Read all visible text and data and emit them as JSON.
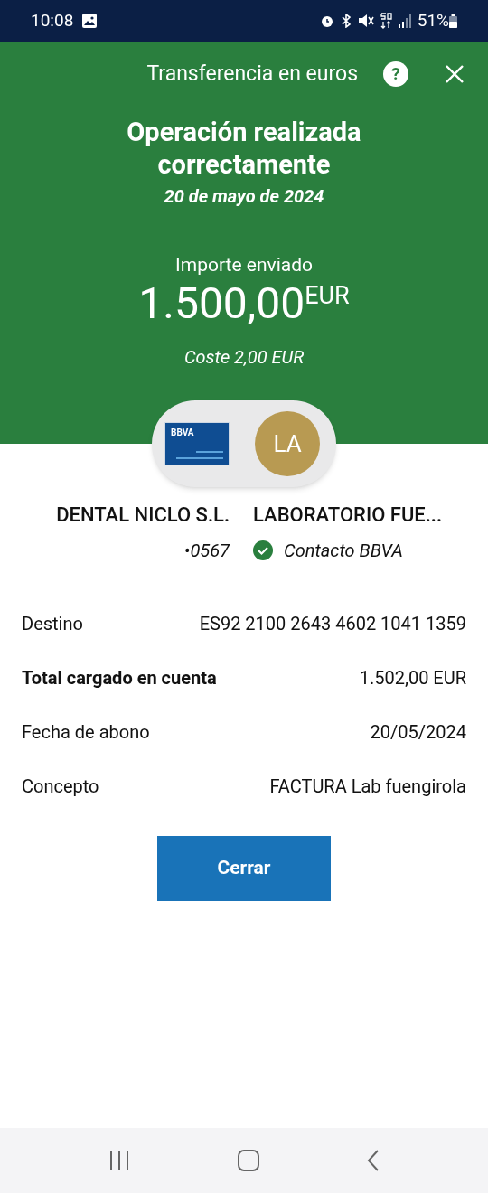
{
  "status_bar": {
    "time": "10:08",
    "battery": "51%"
  },
  "header": {
    "title": "Transferencia en euros",
    "help_icon": "?"
  },
  "result": {
    "title": "Operación realizada correctamente",
    "date": "20 de mayo de 2024",
    "amount_label": "Importe enviado",
    "amount": "1.500,00",
    "currency": "EUR",
    "cost": "Coste 2,00 EUR"
  },
  "origin": {
    "card_logo": "BBVA",
    "name": "DENTAL NICLO S.L.",
    "account": "•0567"
  },
  "recipient": {
    "initials": "LA",
    "name": "LABORATORIO FUE...",
    "verified": true,
    "contact": "Contacto BBVA"
  },
  "details": [
    {
      "label": "Destino",
      "value": "ES92 2100 2643 4602 1041 1359",
      "bold": false
    },
    {
      "label": "Total cargado en cuenta",
      "value": "1.502,00 EUR",
      "bold": true
    },
    {
      "label": "Fecha de abono",
      "value": "20/05/2024",
      "bold": false
    },
    {
      "label": "Concepto",
      "value": "FACTURA Lab fuengirola",
      "bold": false
    }
  ],
  "close_button": "Cerrar"
}
